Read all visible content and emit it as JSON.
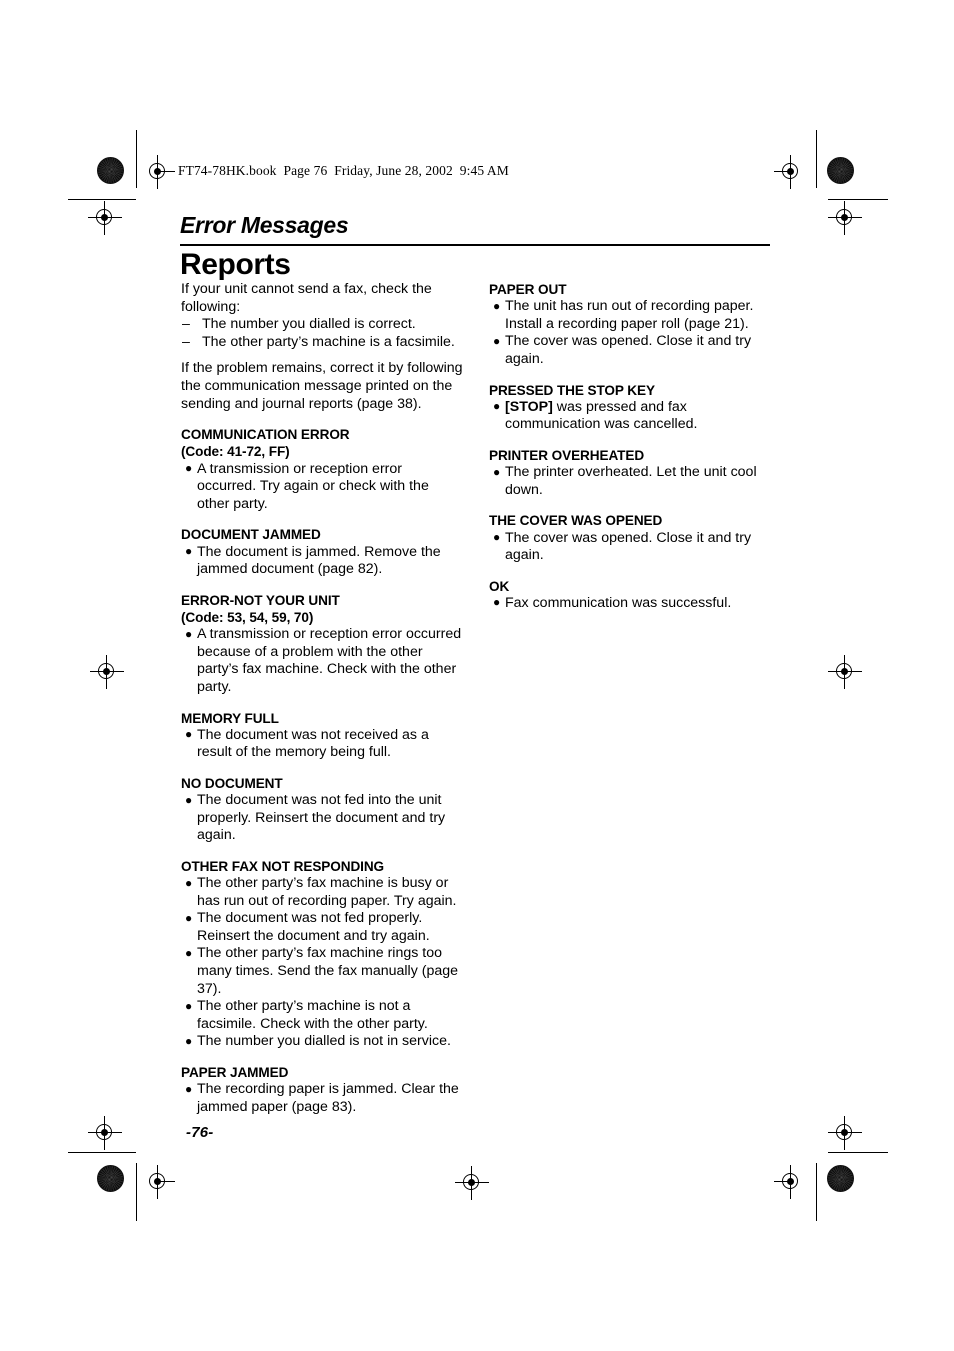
{
  "header": {
    "file_strip": "FT74-78HK.book  Page 76  Friday, June 28, 2002  9:45 AM"
  },
  "chapter": {
    "title": "Error Messages"
  },
  "section": {
    "title": "Reports"
  },
  "intro": {
    "lead": "If your unit cannot send a fax, check the following:",
    "dash_items": [
      {
        "marker": "–",
        "text": "The number you dialled is correct."
      },
      {
        "marker": "–",
        "text": "The other party’s machine is a facsimile."
      }
    ],
    "follow_up": "If the problem remains, correct it by following the communication message printed on the sending and journal reports (page 38)."
  },
  "bullet_glyph": "●",
  "messages_left": [
    {
      "heading": "COMMUNICATION ERROR",
      "heading2": "(Code: 41-72, FF)",
      "items": [
        "A transmission or reception error occurred. Try again or check with the other party."
      ]
    },
    {
      "heading": "DOCUMENT JAMMED",
      "heading2": "",
      "items": [
        "The document is jammed. Remove the jammed document (page 82)."
      ]
    },
    {
      "heading": "ERROR-NOT YOUR UNIT",
      "heading2": "(Code: 53, 54, 59, 70)",
      "items": [
        "A transmission or reception error occurred because of a problem with the other party’s fax machine. Check with the other party."
      ]
    },
    {
      "heading": "MEMORY FULL",
      "heading2": "",
      "items": [
        "The document was not received as a result of the memory being full."
      ]
    },
    {
      "heading": "NO DOCUMENT",
      "heading2": "",
      "items": [
        "The document was not fed into the unit properly. Reinsert the document and try again."
      ]
    },
    {
      "heading": "OTHER FAX NOT RESPONDING",
      "heading2": "",
      "items": [
        "The other party’s fax machine is busy or has run out of recording paper. Try again.",
        "The document was not fed properly. Reinsert the document and try again.",
        "The other party’s fax machine rings too many times. Send the fax manually (page 37).",
        "The other party’s machine is not a facsimile. Check with the other party.",
        "The number you dialled is not in service."
      ]
    },
    {
      "heading": "PAPER JAMMED",
      "heading2": "",
      "items": [
        "The recording paper is jammed. Clear the jammed paper (page 83)."
      ]
    }
  ],
  "messages_right": [
    {
      "heading": "PAPER OUT",
      "heading2": "",
      "items": [
        "The unit has run out of recording paper. Install a recording paper roll (page 21).",
        "The cover was opened. Close it and try again."
      ]
    },
    {
      "heading": "PRESSED THE STOP KEY",
      "heading2": "",
      "items": [
        {
          "key": "[STOP]",
          "text": " was pressed and fax communication was cancelled."
        }
      ]
    },
    {
      "heading": "PRINTER OVERHEATED",
      "heading2": "",
      "items": [
        "The printer overheated. Let the unit cool down."
      ]
    },
    {
      "heading": "THE COVER WAS OPENED",
      "heading2": "",
      "items": [
        "The cover was opened. Close it and try again."
      ]
    },
    {
      "heading": "OK",
      "heading2": "",
      "items": [
        "Fax communication was successful."
      ]
    }
  ],
  "folio": {
    "page_number": "-76-"
  }
}
